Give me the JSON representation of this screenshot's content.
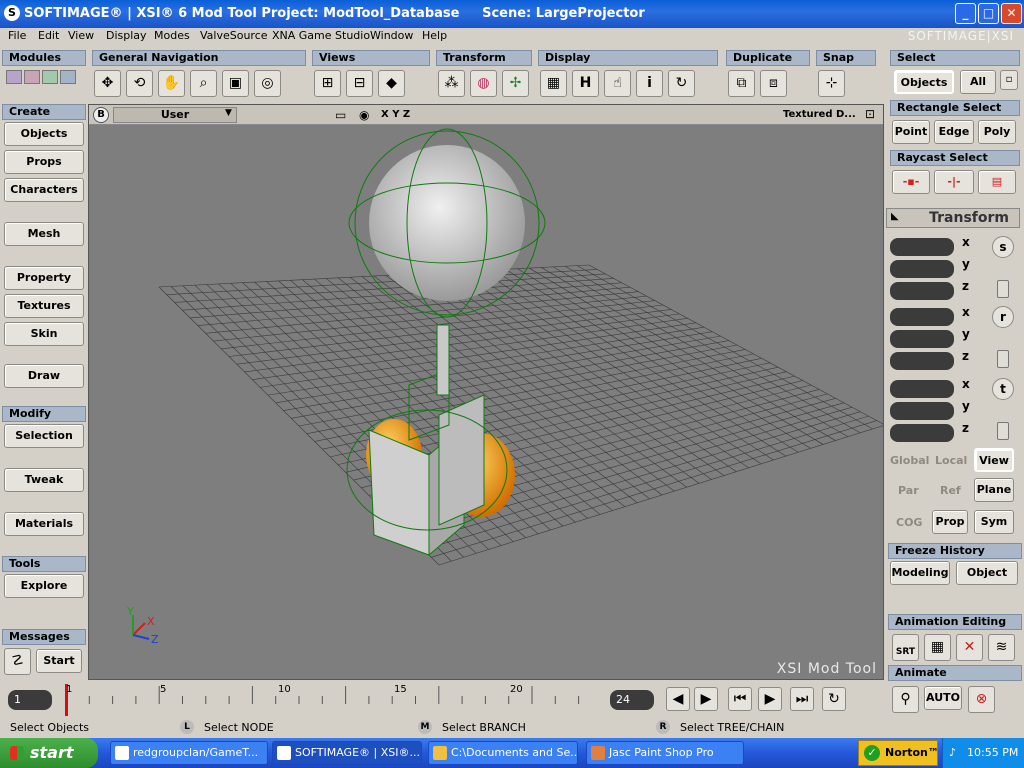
{
  "window": {
    "title": "SOFTIMAGE® | XSI® 6 Mod Tool Project: ModTool_Database     Scene: LargeProjector",
    "brand": "SOFTIMAGE|XSI",
    "min": "_",
    "max": "□",
    "close": "✕"
  },
  "menu": [
    "File",
    "Edit",
    "View",
    "Display",
    "Modes",
    "ValveSource",
    "XNA Game Studio",
    "Window",
    "Help"
  ],
  "toolbar": {
    "modules": "Modules",
    "general_navigation": "General Navigation",
    "views": "Views",
    "transform": "Transform",
    "display": "Display",
    "duplicate": "Duplicate",
    "snap": "Snap"
  },
  "left_panel": {
    "create": "Create",
    "objects": "Objects",
    "props": "Props",
    "characters": "Characters",
    "mesh": "Mesh",
    "property": "Property",
    "textures": "Textures",
    "skin": "Skin",
    "draw": "Draw",
    "modify": "Modify",
    "selection": "Selection",
    "tweak": "Tweak",
    "materials": "Materials",
    "tools": "Tools",
    "explore": "Explore",
    "messages": "Messages",
    "start": "Start"
  },
  "viewport": {
    "letter": "B",
    "camera": "User",
    "axes": "X Y Z",
    "display_mode": "Textured D...",
    "watermark": "XSI Mod Tool",
    "axis_x": "X",
    "axis_y": "Y",
    "axis_z": "Z"
  },
  "right_panel": {
    "select": "Select",
    "objects": "Objects",
    "all": "All",
    "rectangle_select": "Rectangle Select",
    "point": "Point",
    "edge": "Edge",
    "poly": "Poly",
    "raycast_select": "Raycast Select",
    "transform": "Transform",
    "x": "x",
    "y": "y",
    "z": "z",
    "s": "s",
    "r": "r",
    "t": "t",
    "global": "Global",
    "local": "Local",
    "view": "View",
    "par": "Par",
    "ref": "Ref",
    "plane": "Plane",
    "cog": "COG",
    "prop": "Prop",
    "sym": "Sym",
    "freeze_history": "Freeze History",
    "modeling": "Modeling",
    "object": "Object",
    "animation_editing": "Animation Editing",
    "srt": "SRT",
    "animate": "Animate",
    "auto": "AUTO"
  },
  "timeline": {
    "current_frame": "1",
    "end_frame": "24",
    "ticks": [
      "1",
      "5",
      "10",
      "15",
      "20"
    ]
  },
  "status": {
    "left": "Select Objects",
    "l_key": "L",
    "l_text": "Select NODE",
    "m_key": "M",
    "m_text": "Select BRANCH",
    "r_key": "R",
    "r_text": "Select TREE/CHAIN"
  },
  "taskbar": {
    "start": "start",
    "task1": "redgroupclan/GameT...",
    "task2": "SOFTIMAGE® | XSI®...",
    "task3": "C:\\Documents and Se...",
    "task4": "Jasc Paint Shop Pro",
    "norton": "Norton™",
    "clock": "10:55 PM"
  },
  "colors": {
    "title_blue": "#1854c8",
    "panel_header": "#a9b7c8",
    "viewport_bg": "#7e7e7e",
    "grid": "#3a3a3a",
    "selection_green": "#0f7a0f",
    "orange": "#f0a020"
  }
}
